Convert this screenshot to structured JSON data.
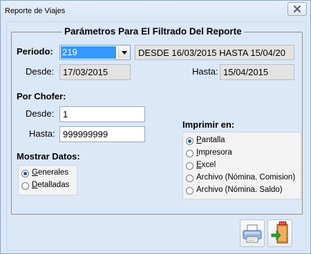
{
  "window": {
    "title": "Reporte de Viajes"
  },
  "filter_group": {
    "title": "Parámetros Para El Filtrado Del Reporte"
  },
  "periodo": {
    "label": "Periodo:",
    "value": "219",
    "range_text": "DESDE 16/03/2015 HASTA 15/04/20",
    "desde_label": "Desde:",
    "desde_value": "17/03/2015",
    "hasta_label": "Hasta:",
    "hasta_value": "15/04/2015"
  },
  "chofer": {
    "label": "Por Chofer:",
    "desde_label": "Desde:",
    "desde_value": "1",
    "hasta_label": "Hasta:",
    "hasta_value": "999999999"
  },
  "mostrar": {
    "label": "Mostrar Datos:",
    "options": [
      {
        "ul": "G",
        "rest": "enerales",
        "selected": true
      },
      {
        "ul": "D",
        "rest": "etalladas",
        "selected": false
      }
    ]
  },
  "imprimir": {
    "label": "Imprimir en:",
    "options": [
      {
        "ul": "P",
        "rest": "antalla",
        "selected": true
      },
      {
        "ul": "I",
        "rest": "mpresora",
        "selected": false
      },
      {
        "ul": "E",
        "rest": "xcel",
        "selected": false
      },
      {
        "ul": "",
        "rest": "Archivo (Nómina. Comision)",
        "selected": false
      },
      {
        "ul": "",
        "rest": "Archivo (Nómina. Saldo)",
        "selected": false
      }
    ]
  },
  "icons": {
    "close": "close-icon",
    "dropdown": "chevron-down-icon",
    "print": "printer-icon",
    "exit": "exit-door-icon"
  },
  "exit_sign": "EXIT",
  "colors": {
    "window_bg": "#dbe8f7",
    "selection": "#3399ff",
    "close_x": "#4a5a70"
  }
}
